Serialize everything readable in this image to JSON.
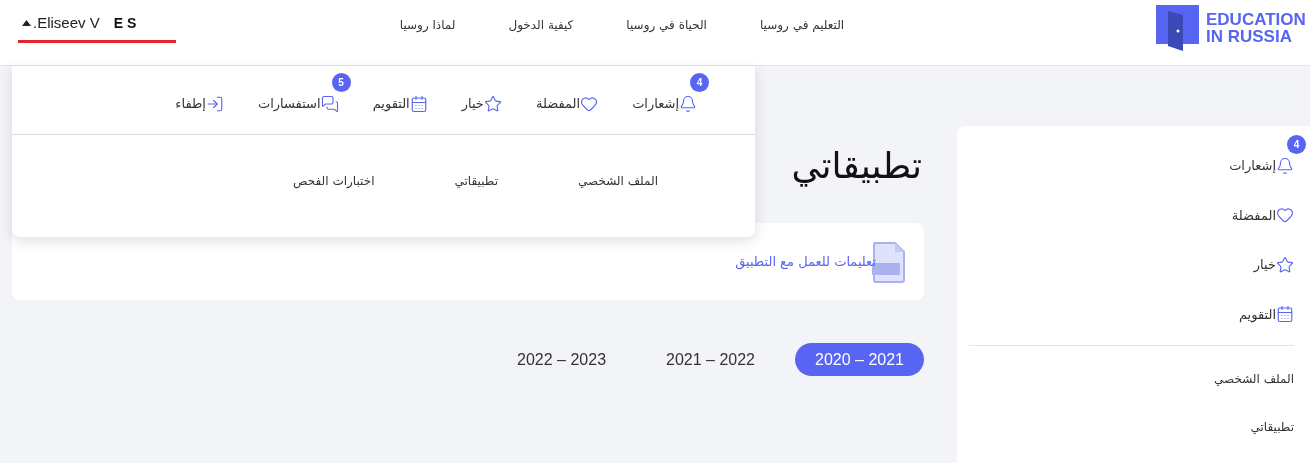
{
  "header": {
    "user": {
      "name": "Eliseev V.",
      "initials": "E S",
      "expanded": true
    },
    "nav": [
      {
        "label": "التعليم في روسيا"
      },
      {
        "label": "الحياة في روسيا"
      },
      {
        "label": "كيفية الدخول"
      },
      {
        "label": "لماذا روسيا"
      }
    ],
    "logo": {
      "line1": "EDUCATION",
      "line2": "IN RUSSIA"
    }
  },
  "user_menu": {
    "items": [
      {
        "kind": "notifications",
        "label": "إشعارات",
        "badge": "4"
      },
      {
        "kind": "favorites",
        "label": "المفضلة"
      },
      {
        "kind": "choice",
        "label": "خيار"
      },
      {
        "kind": "calendar",
        "label": "التقويم"
      },
      {
        "kind": "inquiries",
        "label": "استفسارات",
        "badge": "5"
      },
      {
        "kind": "logout",
        "label": "إطفاء"
      }
    ],
    "links": [
      {
        "label": "الملف الشخصي"
      },
      {
        "label": "تطبيقاتي"
      },
      {
        "label": "اختبارات الفحص"
      }
    ]
  },
  "sidebar": {
    "items": [
      {
        "kind": "notifications",
        "label": "إشعارات",
        "badge": "4"
      },
      {
        "kind": "favorites",
        "label": "المفضلة"
      },
      {
        "kind": "choice",
        "label": "خيار"
      },
      {
        "kind": "calendar",
        "label": "التقويم"
      }
    ],
    "links": [
      {
        "label": "الملف الشخصي"
      },
      {
        "label": "تطبيقاتي"
      }
    ]
  },
  "page_title": "تطبيقاتي",
  "instructions_link": "تعليمات للعمل مع التطبيق",
  "years": [
    {
      "label": "2020 – 2021",
      "selected": true
    },
    {
      "label": "2021 – 2022",
      "selected": false
    },
    {
      "label": "2022 – 2023",
      "selected": false
    }
  ]
}
